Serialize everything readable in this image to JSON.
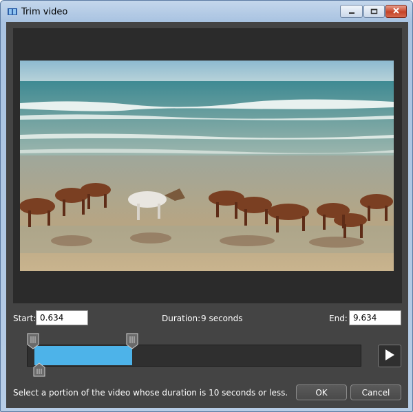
{
  "window": {
    "title": "Trim video",
    "icon": "video-film-icon"
  },
  "caption_buttons": {
    "minimize": "minimize-icon",
    "maximize": "maximize-icon",
    "close": "close-icon"
  },
  "trim": {
    "start_label": "Start:",
    "start_value": "0.634",
    "duration_label": "Duration:",
    "duration_value": "9 seconds",
    "end_label": "End:",
    "end_value": "9.634",
    "selection_start_fraction": 0.0,
    "selection_end_fraction": 0.3,
    "playhead_fraction": 0.0
  },
  "footer": {
    "hint": "Select a portion of the video whose duration is 10 seconds or less.",
    "ok_label": "OK",
    "cancel_label": "Cancel"
  },
  "colors": {
    "selection": "#4db3e9",
    "client_bg": "#444444",
    "video_frame_bg": "#2b2b2b"
  }
}
